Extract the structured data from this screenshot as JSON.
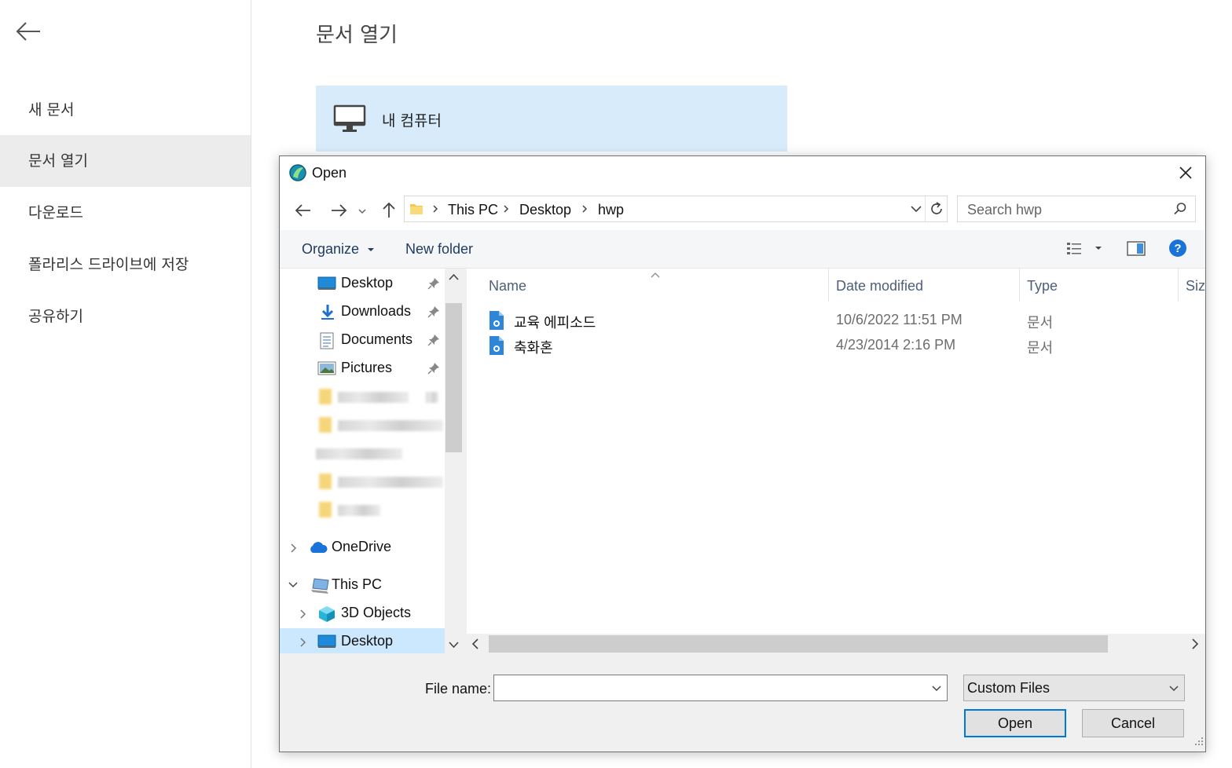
{
  "app": {
    "page_title": "문서 열기",
    "nav": [
      {
        "label": "새 문서"
      },
      {
        "label": "문서 열기"
      },
      {
        "label": "다운로드"
      },
      {
        "label": "폴라리스 드라이브에 저장"
      },
      {
        "label": "공유하기"
      }
    ],
    "active_nav": "문서 열기",
    "location_card": {
      "label": "내 컴퓨터",
      "icon": "monitor-icon"
    }
  },
  "dialog": {
    "title": "Open",
    "breadcrumb": [
      "This PC",
      "Desktop",
      "hwp"
    ],
    "search_placeholder": "Search hwp",
    "toolbar": {
      "organize_label": "Organize",
      "new_folder_label": "New folder"
    },
    "tree": {
      "quick_access": [
        {
          "label": "Desktop",
          "icon": "desktop-folder-icon",
          "pinned": true
        },
        {
          "label": "Downloads",
          "icon": "download-arrow-icon",
          "pinned": true
        },
        {
          "label": "Documents",
          "icon": "documents-icon",
          "pinned": true
        },
        {
          "label": "Pictures",
          "icon": "pictures-icon",
          "pinned": true
        }
      ],
      "onedrive": {
        "label": "OneDrive",
        "icon": "cloud-icon"
      },
      "this_pc": {
        "label": "This PC",
        "icon": "computer-icon"
      },
      "this_pc_children": [
        {
          "label": "3D Objects",
          "icon": "cube-icon"
        },
        {
          "label": "Desktop",
          "icon": "desktop-folder-icon",
          "selected": true
        }
      ]
    },
    "columns": {
      "name": "Name",
      "date": "Date modified",
      "type": "Type",
      "size": "Size"
    },
    "files": [
      {
        "name": "교육 에피소드",
        "date": "10/6/2022 11:51 PM",
        "type": "문서",
        "icon": "hwp-document-icon"
      },
      {
        "name": "축화혼",
        "date": "4/23/2014 2:16 PM",
        "type": "문서",
        "icon": "hwp-document-icon"
      }
    ],
    "file_name_label": "File name:",
    "file_name_value": "",
    "file_type_filter": "Custom Files",
    "open_label": "Open",
    "cancel_label": "Cancel"
  },
  "colors": {
    "accent": "#0078d7",
    "selection": "#cce8ff",
    "card": "#d7ebfb"
  }
}
